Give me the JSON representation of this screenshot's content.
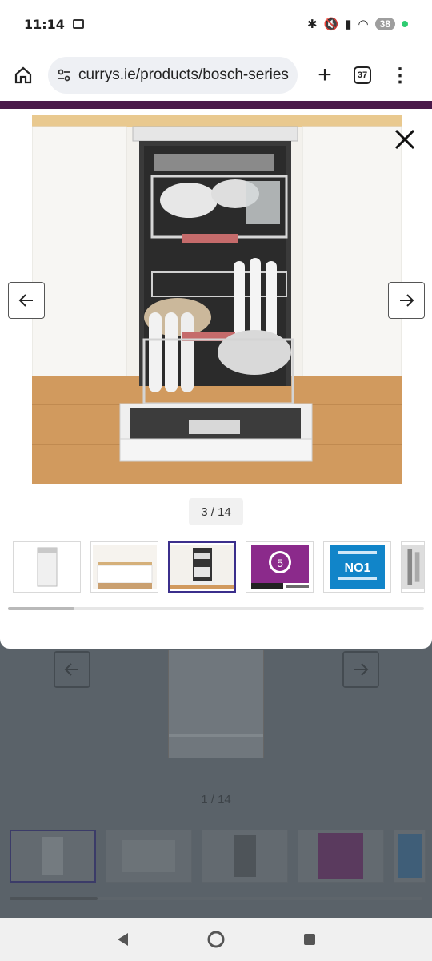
{
  "status_bar": {
    "time": "11:14",
    "battery": "38"
  },
  "browser": {
    "url": "currys.ie/products/bosch-series",
    "tab_count": "37"
  },
  "modal": {
    "counter": "3 / 14",
    "thumbnails": [
      {
        "name": "dishwasher-front"
      },
      {
        "name": "kitchen-lifestyle"
      },
      {
        "name": "dishwasher-open",
        "active": true
      },
      {
        "name": "warranty-5-years",
        "badge_text": "5"
      },
      {
        "name": "no1-brand",
        "badge_text": "NO1"
      },
      {
        "name": "interior-detail"
      }
    ],
    "scroll_progress": 0.16
  },
  "background_page": {
    "counter": "1 / 14"
  },
  "colors": {
    "accent_purple": "#4a1a4a",
    "thumb_active_border": "#3b2f8c",
    "warranty_purple": "#8b2a8b",
    "brand_blue": "#1185c9"
  }
}
